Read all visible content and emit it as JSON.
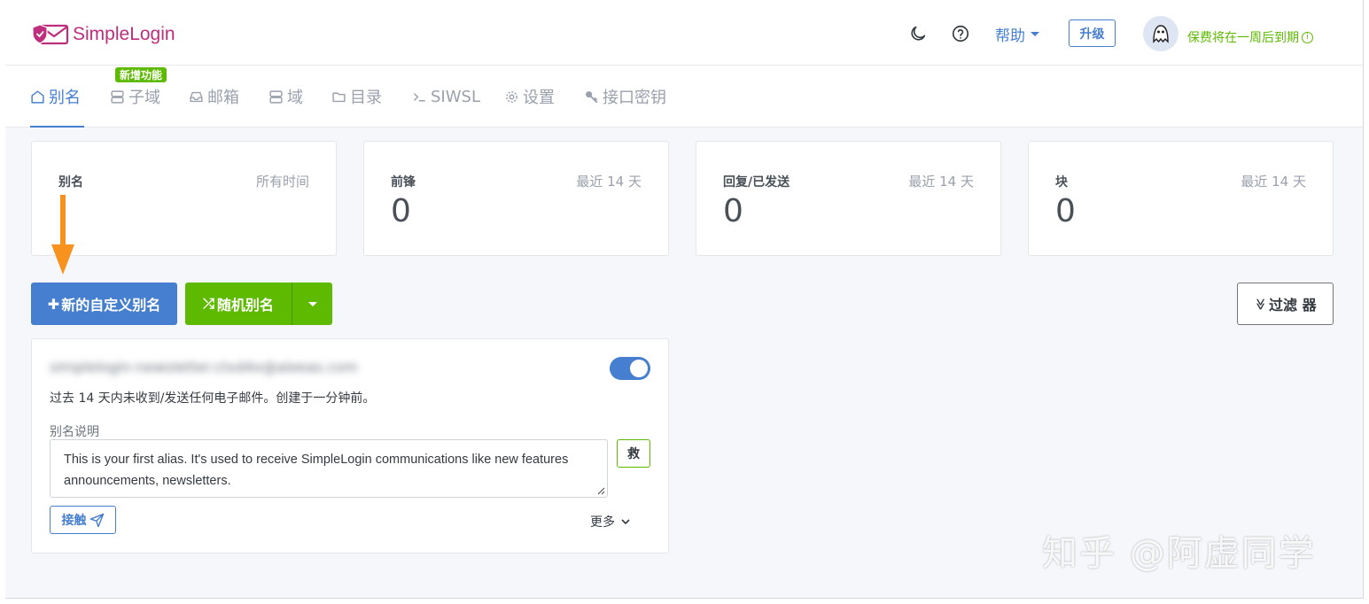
{
  "header": {
    "logo_text": "SimpleLogin",
    "help_label": "帮助",
    "upgrade_label": "升级",
    "expiry_text": "保费将在一周后到期",
    "info_glyph": "i"
  },
  "nav": {
    "items": [
      {
        "label": "别名",
        "icon": "home-icon"
      },
      {
        "label": "子域",
        "icon": "server-icon"
      },
      {
        "label": "邮箱",
        "icon": "inbox-icon"
      },
      {
        "label": "域",
        "icon": "server-icon"
      },
      {
        "label": "目录",
        "icon": "folder-icon"
      },
      {
        "label": "SIWSL",
        "icon": "terminal-icon"
      },
      {
        "label": "设置",
        "icon": "gear-icon"
      },
      {
        "label": "接口密钥",
        "icon": "key-icon"
      }
    ],
    "new_badge": "新增功能"
  },
  "stats": [
    {
      "label": "别名",
      "period": "所有时间",
      "value": ""
    },
    {
      "label": "前锋",
      "period": "最近 14 天",
      "value": "0"
    },
    {
      "label": "回复/已发送",
      "period": "最近 14 天",
      "value": "0"
    },
    {
      "label": "块",
      "period": "最近 14 天",
      "value": "0"
    }
  ],
  "actions": {
    "new_custom_alias": "新的自定义别名",
    "plus_glyph": "✚",
    "random_alias": "随机别名",
    "shuffle_glyph": "⤮",
    "filter": "过滤 器",
    "filter_glyph": "≫"
  },
  "alias": {
    "email": "simplelogin-newsletter.ctxd4x@aleeas.com",
    "enabled": true,
    "activity": "过去 14 天内未收到/发送任何电子邮件。创建于一分钟前。",
    "note_label": "别名说明",
    "note": "This is your first alias. It's used to receive SimpleLogin communications like new features announcements, newsletters.",
    "save_label": "救",
    "contact_label": "接触",
    "more_label": "更多"
  },
  "watermark": "知乎 @阿虚同学",
  "colors": {
    "primary": "#467fcf",
    "success": "#5eba00",
    "brand": "#be2e7c",
    "arrow": "#f7921e"
  }
}
